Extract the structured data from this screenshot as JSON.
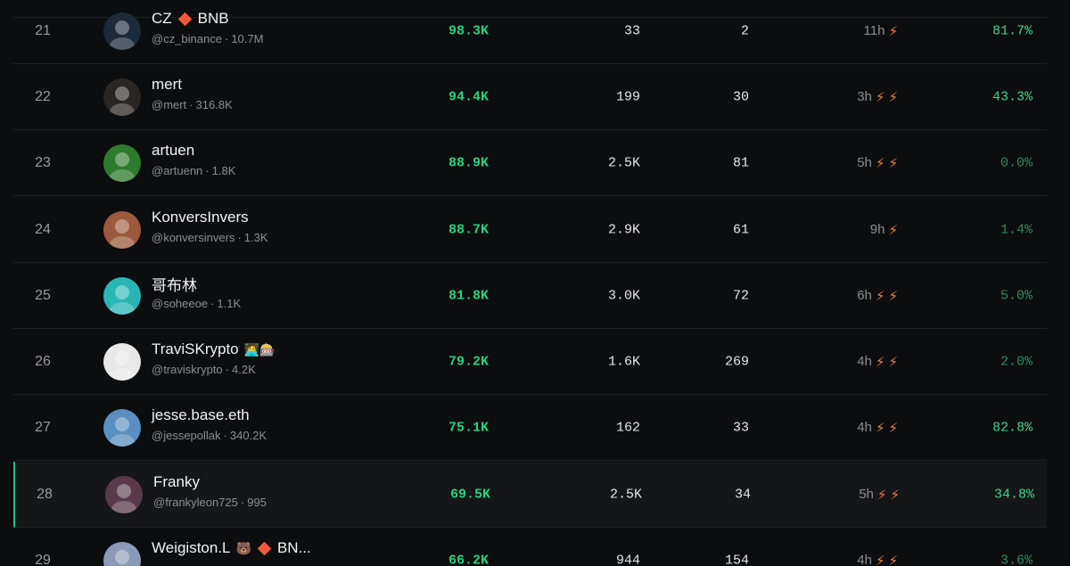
{
  "rows": [
    {
      "rank": "21",
      "name": "CZ",
      "name_suffix": "BNB",
      "has_diamond": true,
      "handle": "@cz_binance",
      "followers": "10.7M",
      "score": "98.3K",
      "col_a": "33",
      "col_b": "2",
      "time": "11h",
      "bolts": 1,
      "pct": "81.7%",
      "pct_level": "high",
      "avatar_color": "#1c2a3a"
    },
    {
      "rank": "22",
      "name": "mert",
      "handle": "@mert",
      "followers": "316.8K",
      "score": "94.4K",
      "col_a": "199",
      "col_b": "30",
      "time": "3h",
      "bolts": 2,
      "pct": "43.3%",
      "pct_level": "high",
      "avatar_color": "#2a2623"
    },
    {
      "rank": "23",
      "name": "artuen",
      "handle": "@artuenn",
      "followers": "1.8K",
      "score": "88.9K",
      "col_a": "2.5K",
      "col_b": "81",
      "time": "5h",
      "bolts": 2,
      "pct": "0.0%",
      "pct_level": "low",
      "avatar_color": "#2e7a2e"
    },
    {
      "rank": "24",
      "name": "KonversInvers",
      "handle": "@konversinvers",
      "followers": "1.3K",
      "score": "88.7K",
      "col_a": "2.9K",
      "col_b": "61",
      "time": "9h",
      "bolts": 1,
      "pct": "1.4%",
      "pct_level": "low",
      "avatar_color": "#9b5a3e"
    },
    {
      "rank": "25",
      "name": "哥布林",
      "handle": "@soheeoe",
      "followers": "1.1K",
      "score": "81.8K",
      "col_a": "3.0K",
      "col_b": "72",
      "time": "6h",
      "bolts": 2,
      "pct": "5.0%",
      "pct_level": "low",
      "avatar_color": "#2ab5b5"
    },
    {
      "rank": "26",
      "name": "TraviSKrypto",
      "name_emoji": "🧑‍💻🎰",
      "handle": "@traviskrypto",
      "followers": "4.2K",
      "score": "79.2K",
      "col_a": "1.6K",
      "col_b": "269",
      "time": "4h",
      "bolts": 2,
      "pct": "2.0%",
      "pct_level": "low",
      "avatar_color": "#e8e8e8"
    },
    {
      "rank": "27",
      "name": "jesse.base.eth",
      "handle": "@jessepollak",
      "followers": "340.2K",
      "score": "75.1K",
      "col_a": "162",
      "col_b": "33",
      "time": "4h",
      "bolts": 2,
      "pct": "82.8%",
      "pct_level": "high",
      "avatar_color": "#5a8fc0"
    },
    {
      "rank": "28",
      "name": "Franky",
      "handle": "@frankyleon725",
      "followers": "995",
      "score": "69.5K",
      "col_a": "2.5K",
      "col_b": "34",
      "time": "5h",
      "bolts": 2,
      "pct": "34.8%",
      "pct_level": "high",
      "avatar_color": "#5a3a4a",
      "highlighted": true
    },
    {
      "rank": "29",
      "name": "Weigiston.L",
      "name_emoji": "🐻",
      "has_diamond": true,
      "name_suffix": "BN...",
      "handle": "",
      "followers": "",
      "score": "66.2K",
      "col_a": "944",
      "col_b": "154",
      "time": "4h",
      "bolts": 2,
      "pct": "3.6%",
      "pct_level": "low",
      "avatar_color": "#8a9ab8"
    }
  ],
  "icons": {
    "bolt": "lightning-icon",
    "diamond": "bnb-diamond-icon"
  },
  "colors": {
    "score": "#24d37e",
    "bolt": "#ff7a3d",
    "accent": "#19c37d"
  }
}
